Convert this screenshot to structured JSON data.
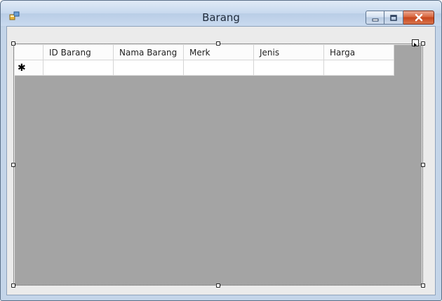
{
  "window": {
    "title": "Barang",
    "app_icon": "form-icon",
    "controls": [
      "minimize-icon",
      "maximize-icon",
      "close-icon"
    ]
  },
  "grid": {
    "columns": [
      "ID Barang",
      "Nama Barang",
      "Merk",
      "Jenis",
      "Harga"
    ],
    "new_row_marker": "✱",
    "rows": [
      [
        "",
        "",
        "",
        "",
        ""
      ]
    ]
  },
  "colors": {
    "grid_background": "#a4a4a4",
    "close_button": "#c6451d",
    "titlebar": "#c7d9ee"
  }
}
